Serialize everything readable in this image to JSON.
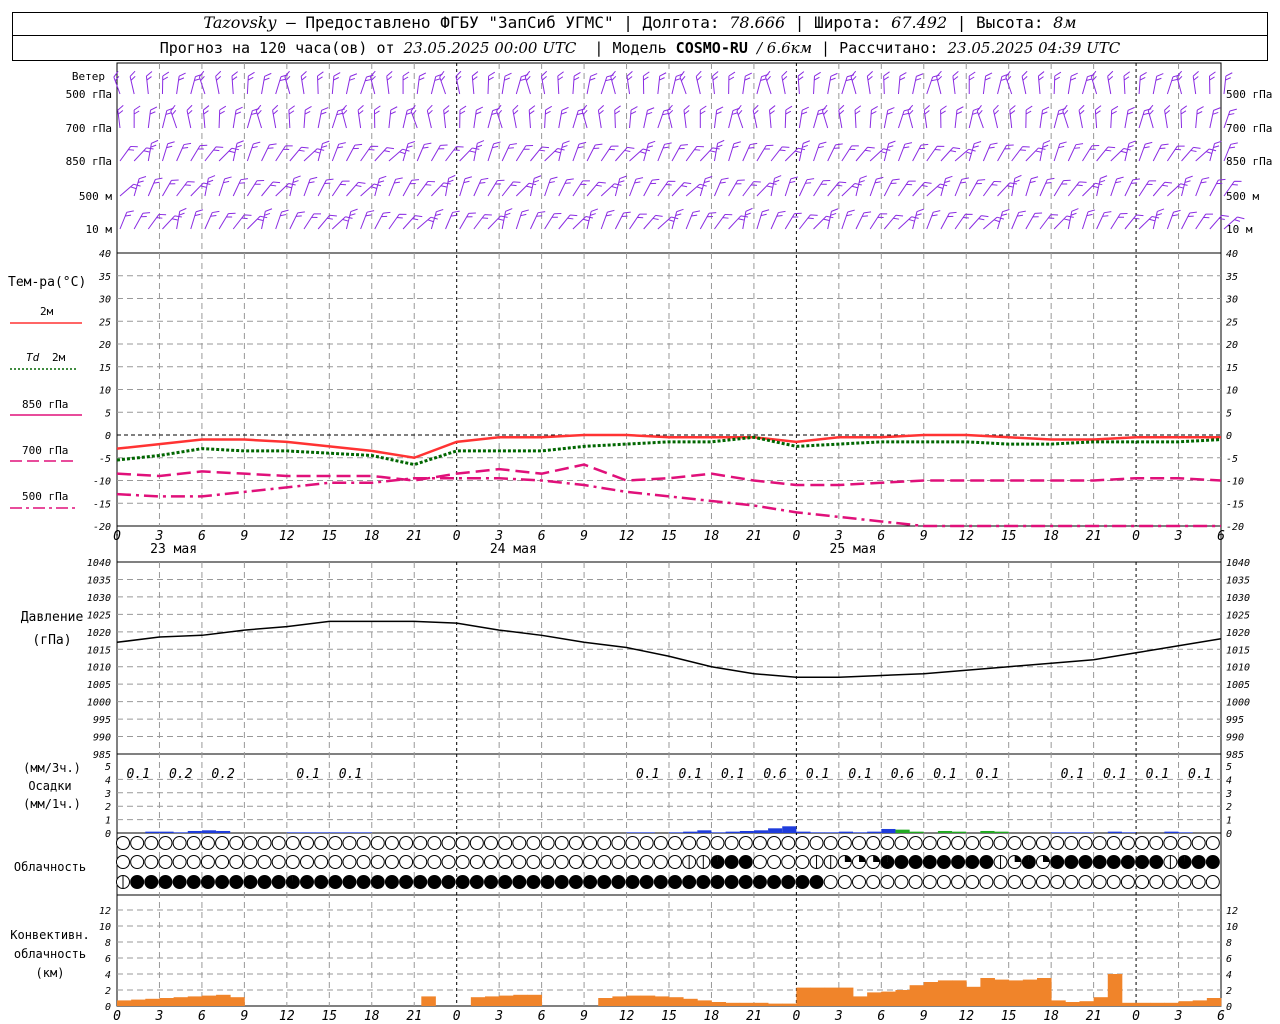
{
  "header": {
    "station": "Tazovsky",
    "provided_by": "— Предоставлено ФГБУ \"ЗапСиб УГМС\"",
    "lon_label": "Долгота:",
    "lon_value": "78.666",
    "lat_label": "Широта:",
    "lat_value": "67.492",
    "alt_label": "Высота:",
    "alt_value": "8м",
    "forecast_label": "Прогноз на 120 часа(ов) от",
    "forecast_start": "23.05.2025 00:00 UTC",
    "model_label": "Модель",
    "model_name": "COSMO-RU",
    "model_res": "/ 6.6км",
    "computed_label": "Рассчитано:",
    "computed_time": "23.05.2025 04:39 UTC"
  },
  "labels": {
    "wind": "Ветер",
    "levels": [
      "500 гПа",
      "700 гПа",
      "850 гПа",
      "500 м",
      "10 м"
    ],
    "temp_title": "Тем-ра(°C)",
    "t2m": "2м",
    "td_prefix": "Td",
    "td2m": "2м",
    "t850": "850 гПа",
    "t700": "700 гПа",
    "t500": "500 гПа",
    "pressure_title": "Давление",
    "pressure_unit": "(гПа)",
    "precip_unit3": "(мм/3ч.)",
    "precip_title": "Осадки",
    "precip_unit1": "(мм/1ч.)",
    "cloud_title": "Облачность",
    "conv_title1": "Конвективн.",
    "conv_title2": "облачность",
    "conv_unit": "(км)"
  },
  "colors": {
    "t2m": "#ff3333",
    "td2m": "#006600",
    "t850": "#e0107a",
    "t700": "#e0107a",
    "t500": "#e0107a",
    "wind": "#8a2be2",
    "precip": "#1e3cdc",
    "precip_green": "#22aa22",
    "conv": "#f0842a",
    "grid": "#999999"
  },
  "chart_data": {
    "type": "line",
    "x_ticks": [
      "0",
      "3",
      "6",
      "9",
      "12",
      "15",
      "18",
      "21",
      "0",
      "3",
      "6",
      "9",
      "12",
      "15",
      "18",
      "21",
      "0",
      "3",
      "6",
      "9",
      "12",
      "15",
      "18",
      "21",
      "0",
      "3",
      "6",
      "9",
      "12",
      "15",
      "18",
      "21",
      "0",
      "3",
      "6"
    ],
    "day_labels": [
      "23 мая",
      "24 мая",
      "25 мая"
    ],
    "temperature": {
      "ylim": [
        -20,
        40
      ],
      "yticks": [
        "40",
        "35",
        "30",
        "25",
        "20",
        "15",
        "10",
        "5",
        "0",
        "-5",
        "-10",
        "-15",
        "-20"
      ],
      "series": [
        {
          "name": "2м",
          "key": "t2m",
          "hours": [
            0,
            3,
            6,
            9,
            12,
            15,
            18,
            21,
            24,
            27,
            30,
            33,
            36,
            39,
            42,
            45,
            48,
            51,
            54,
            57,
            60,
            63,
            66,
            69,
            72,
            75,
            78
          ],
          "values": [
            -3,
            -2,
            -1,
            -1,
            -1.5,
            -2.5,
            -3.5,
            -5,
            -1.5,
            -0.5,
            -0.5,
            0,
            0,
            -0.5,
            -0.5,
            -0.5,
            -1.5,
            -0.5,
            -0.5,
            0,
            0,
            -0.5,
            -1,
            -1,
            -0.5,
            -0.5,
            -0.5
          ]
        },
        {
          "name": "Td 2м",
          "key": "td2m",
          "hours": [
            0,
            3,
            6,
            9,
            12,
            15,
            18,
            21,
            24,
            27,
            30,
            33,
            36,
            39,
            42,
            45,
            48,
            51,
            54,
            57,
            60,
            63,
            66,
            69,
            72,
            75,
            78
          ],
          "values": [
            -5.5,
            -4.5,
            -3,
            -3.5,
            -3.5,
            -4,
            -4.5,
            -6.5,
            -3.5,
            -3.5,
            -3.5,
            -2.5,
            -2,
            -1.5,
            -1.5,
            -0.5,
            -2.5,
            -2,
            -1.5,
            -1.5,
            -1.5,
            -2,
            -2,
            -1.5,
            -1.5,
            -1.5,
            -1
          ]
        },
        {
          "name": "850 гПа",
          "key": "t850",
          "hours": [
            0,
            3,
            6,
            9,
            12,
            15,
            18,
            21,
            24,
            27,
            30,
            33,
            36,
            39,
            42,
            45,
            48,
            51,
            54,
            57,
            60,
            63,
            66,
            69,
            72,
            75,
            78
          ],
          "values": [
            -8.5,
            -9,
            -8,
            -8.5,
            -9,
            -9,
            -9,
            -10,
            -8.5,
            -7.5,
            -8.5,
            -6.5,
            -10,
            -9.5,
            -8.5,
            -10,
            -11,
            -11,
            -10.5,
            -10,
            -10,
            -10,
            -10,
            -10,
            -9.5,
            -9.5,
            -10
          ]
        },
        {
          "name": "700 гПа",
          "key": "t700",
          "hours": [
            0,
            3,
            6,
            9,
            12,
            15,
            18,
            21,
            24,
            27,
            30,
            33,
            36,
            39,
            42,
            45,
            48,
            51,
            54,
            57,
            60,
            63,
            66,
            69,
            72,
            75,
            78
          ],
          "values": [
            -13,
            -13.5,
            -13.5,
            -12.5,
            -11.5,
            -10.5,
            -10.5,
            -9.5,
            -9.5,
            -9.5,
            -10,
            -11,
            -12.5,
            -13.5,
            -14.5,
            -15.5,
            -17,
            -18,
            -19,
            -20.5,
            -21,
            -21.5,
            -21.5,
            -21.5,
            -21.5,
            -21,
            -20
          ]
        }
      ]
    },
    "pressure": {
      "ylim": [
        985,
        1040
      ],
      "yticks": [
        "1040",
        "1035",
        "1030",
        "1025",
        "1020",
        "1015",
        "1010",
        "1005",
        "1000",
        "995",
        "990",
        "985"
      ],
      "hours": [
        0,
        3,
        6,
        9,
        12,
        15,
        18,
        21,
        24,
        27,
        30,
        33,
        36,
        39,
        42,
        45,
        48,
        51,
        54,
        57,
        60,
        63,
        66,
        69,
        72,
        75,
        78
      ],
      "values": [
        1017,
        1018.5,
        1019,
        1020.5,
        1021.5,
        1023,
        1023,
        1023,
        1022.5,
        1020.5,
        1019,
        1017,
        1015.5,
        1013,
        1010,
        1008,
        1007,
        1007,
        1007.5,
        1008,
        1009,
        1010,
        1011,
        1012,
        1014,
        1016,
        1018
      ]
    },
    "precip": {
      "ylim": [
        0,
        5
      ],
      "yticks": [
        "5",
        "4",
        "3",
        "2",
        "1",
        "0"
      ],
      "labels_3h": [
        {
          "hour": 1.5,
          "text": "0.1"
        },
        {
          "hour": 4.5,
          "text": "0.2"
        },
        {
          "hour": 7.5,
          "text": "0.2"
        },
        {
          "hour": 13.5,
          "text": "0.1"
        },
        {
          "hour": 16.5,
          "text": "0.1"
        },
        {
          "hour": 37.5,
          "text": "0.1"
        },
        {
          "hour": 40.5,
          "text": "0.1"
        },
        {
          "hour": 43.5,
          "text": "0.1"
        },
        {
          "hour": 46.5,
          "text": "0.6"
        },
        {
          "hour": 49.5,
          "text": "0.1"
        },
        {
          "hour": 52.5,
          "text": "0.1"
        },
        {
          "hour": 55.5,
          "text": "0.6"
        },
        {
          "hour": 58.5,
          "text": "0.1"
        },
        {
          "hour": 61.5,
          "text": "0.1"
        },
        {
          "hour": 67.5,
          "text": "0.1"
        },
        {
          "hour": 70.5,
          "text": "0.1"
        },
        {
          "hour": 73.5,
          "text": "0.1"
        },
        {
          "hour": 76.5,
          "text": "0.1"
        }
      ],
      "hourly": [
        [
          2,
          0.1
        ],
        [
          3,
          0.1
        ],
        [
          4,
          0.05
        ],
        [
          5,
          0.15
        ],
        [
          6,
          0.2
        ],
        [
          7,
          0.15
        ],
        [
          12,
          0.05
        ],
        [
          13,
          0.05
        ],
        [
          14,
          0.05
        ],
        [
          15,
          0.05
        ],
        [
          16,
          0.05
        ],
        [
          17,
          0.05
        ],
        [
          36,
          0.05
        ],
        [
          37,
          0.05
        ],
        [
          39,
          0.05
        ],
        [
          40,
          0.1
        ],
        [
          41,
          0.2
        ],
        [
          42,
          0.05
        ],
        [
          43,
          0.1
        ],
        [
          44,
          0.15
        ],
        [
          45,
          0.2
        ],
        [
          46,
          0.35
        ],
        [
          47,
          0.5
        ],
        [
          48,
          0.1
        ],
        [
          49,
          0.05
        ],
        [
          50,
          0.05
        ],
        [
          51,
          0.1
        ],
        [
          52,
          0.05
        ],
        [
          53,
          0.1
        ],
        [
          54,
          0.3
        ],
        [
          55,
          0.2
        ],
        [
          66,
          0.05
        ],
        [
          67,
          0.05
        ],
        [
          68,
          0.05
        ],
        [
          70,
          0.1
        ],
        [
          71,
          0.05
        ],
        [
          74,
          0.1
        ],
        [
          75,
          0.05
        ]
      ],
      "hourly_green": [
        [
          55,
          0.25
        ],
        [
          56,
          0.1
        ],
        [
          58,
          0.15
        ],
        [
          59,
          0.1
        ],
        [
          61,
          0.15
        ],
        [
          62,
          0.1
        ]
      ]
    },
    "convective": {
      "ylim": [
        0,
        13
      ],
      "yticks": [
        "12",
        "10",
        "8",
        "6",
        "4",
        "2",
        "0"
      ],
      "bars": [
        [
          0,
          0.7
        ],
        [
          1,
          0.8
        ],
        [
          2,
          0.9
        ],
        [
          3,
          1
        ],
        [
          4,
          1.1
        ],
        [
          5,
          1.2
        ],
        [
          6,
          1.3
        ],
        [
          7,
          1.4
        ],
        [
          8,
          1.1
        ],
        [
          21.5,
          1.2
        ],
        [
          25,
          1.1
        ],
        [
          26,
          1.2
        ],
        [
          27,
          1.3
        ],
        [
          28,
          1.4
        ],
        [
          29,
          1.4
        ],
        [
          34,
          1
        ],
        [
          35,
          1.2
        ],
        [
          36,
          1.3
        ],
        [
          37,
          1.3
        ],
        [
          38,
          1.2
        ],
        [
          39,
          1.1
        ],
        [
          40,
          0.9
        ],
        [
          41,
          0.7
        ],
        [
          42,
          0.5
        ],
        [
          43,
          0.4
        ],
        [
          44,
          0.4
        ],
        [
          45,
          0.4
        ],
        [
          46,
          0.3
        ],
        [
          47,
          0.3
        ],
        [
          48,
          2.3
        ],
        [
          49,
          2.3
        ],
        [
          50,
          2.3
        ],
        [
          51,
          2.3
        ],
        [
          52,
          1.2
        ],
        [
          53,
          1.7
        ],
        [
          54,
          1.8
        ],
        [
          55,
          2
        ],
        [
          56,
          2.6
        ],
        [
          57,
          3
        ],
        [
          58,
          3.2
        ],
        [
          59,
          3.2
        ],
        [
          60,
          2.4
        ],
        [
          61,
          3.5
        ],
        [
          62,
          3.3
        ],
        [
          63,
          3.2
        ],
        [
          64,
          3.3
        ],
        [
          65,
          3.5
        ],
        [
          66,
          0.7
        ],
        [
          67,
          0.5
        ],
        [
          68,
          0.6
        ],
        [
          69,
          1.1
        ],
        [
          70,
          4
        ],
        [
          71,
          0.4
        ],
        [
          72,
          0.4
        ],
        [
          73,
          0.4
        ],
        [
          74,
          0.4
        ],
        [
          75,
          0.6
        ],
        [
          76,
          0.7
        ],
        [
          77,
          1
        ],
        [
          78,
          1.1
        ],
        [
          79,
          1.1
        ]
      ]
    },
    "clouds": {
      "rows": 3,
      "count": 51,
      "row_top": "0000000000000000000000000000000000000000000000000000",
      "row_mid": "0000000000000000000000000000000000000000113440000112223444444412324444444413444444400443",
      "row_low": "14444444444434444444444444444444444444444444444444"
    },
    "winds": {
      "rows": 5,
      "levels": [
        "500 гПа",
        "700 гПа",
        "850 гПа",
        "500 м",
        "10 м"
      ]
    }
  }
}
